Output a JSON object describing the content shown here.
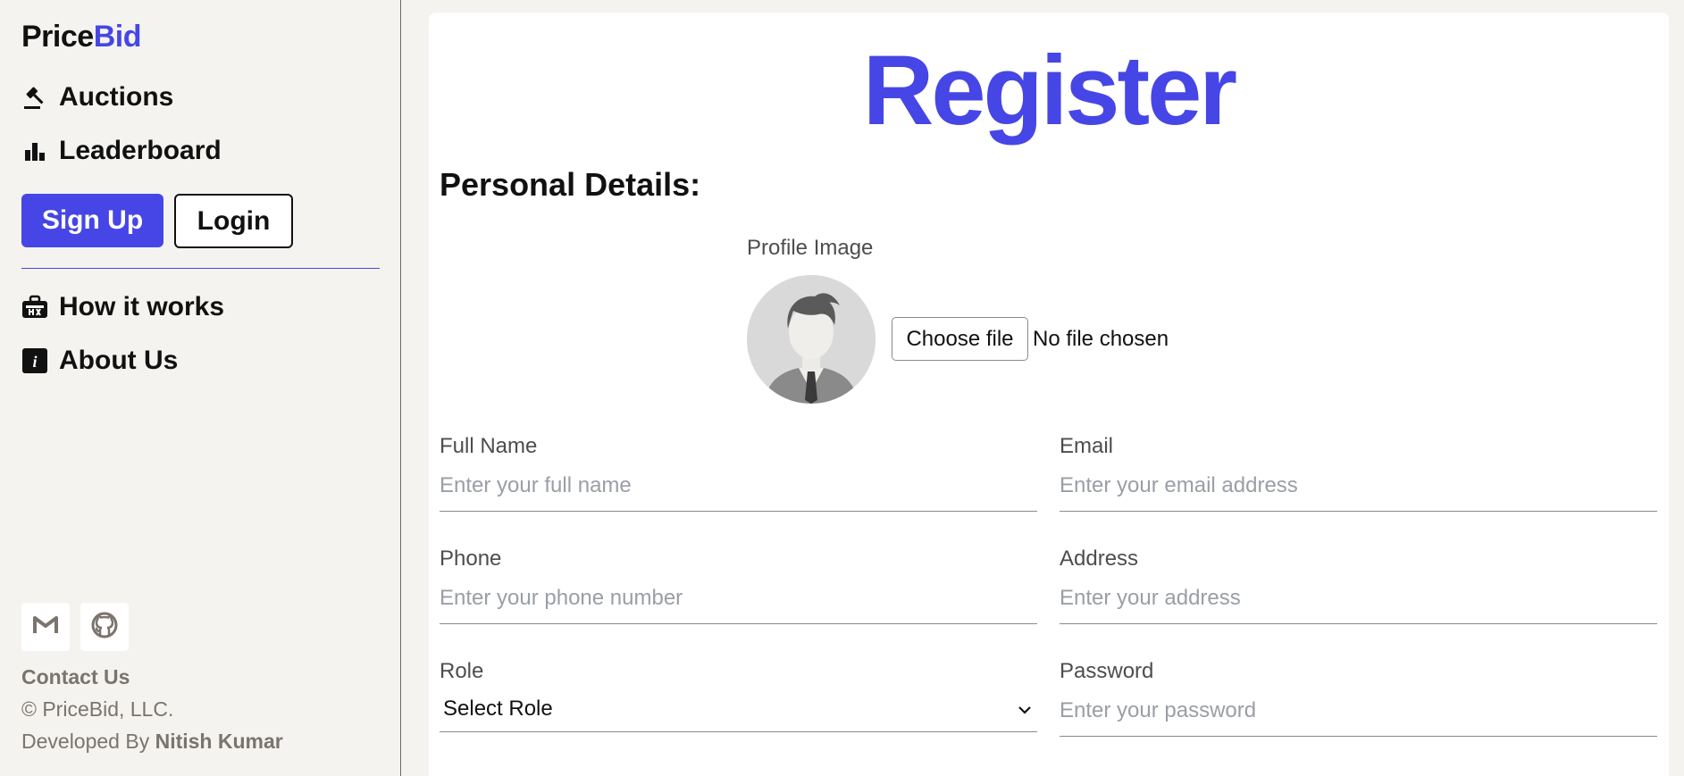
{
  "brand": {
    "name_part1": "Price",
    "name_part2": "Bid",
    "accent_color": "#4646e6"
  },
  "sidebar": {
    "nav": [
      {
        "label": "Auctions",
        "icon": "gavel-icon"
      },
      {
        "label": "Leaderboard",
        "icon": "bar-chart-icon"
      }
    ],
    "signup_label": "Sign Up",
    "login_label": "Login",
    "nav_secondary": [
      {
        "label": "How it works",
        "icon": "toolbox-icon"
      },
      {
        "label": "About Us",
        "icon": "info-icon"
      }
    ],
    "social": [
      "gmail-icon",
      "github-icon"
    ],
    "footer": {
      "contact": "Contact Us",
      "copyright": "© PriceBid, LLC.",
      "developed_prefix": "Developed By ",
      "developer": "Nitish Kumar"
    }
  },
  "main": {
    "title": "Register",
    "section_title": "Personal Details:",
    "profile_label": "Profile Image",
    "file_button": "Choose file",
    "file_status": "No file chosen",
    "fields": {
      "full_name": {
        "label": "Full Name",
        "placeholder": "Enter your full name"
      },
      "email": {
        "label": "Email",
        "placeholder": "Enter your email address"
      },
      "phone": {
        "label": "Phone",
        "placeholder": "Enter your phone number"
      },
      "address": {
        "label": "Address",
        "placeholder": "Enter your address"
      },
      "role": {
        "label": "Role",
        "selected": "Select Role"
      },
      "password": {
        "label": "Password",
        "placeholder": "Enter your password"
      }
    }
  }
}
